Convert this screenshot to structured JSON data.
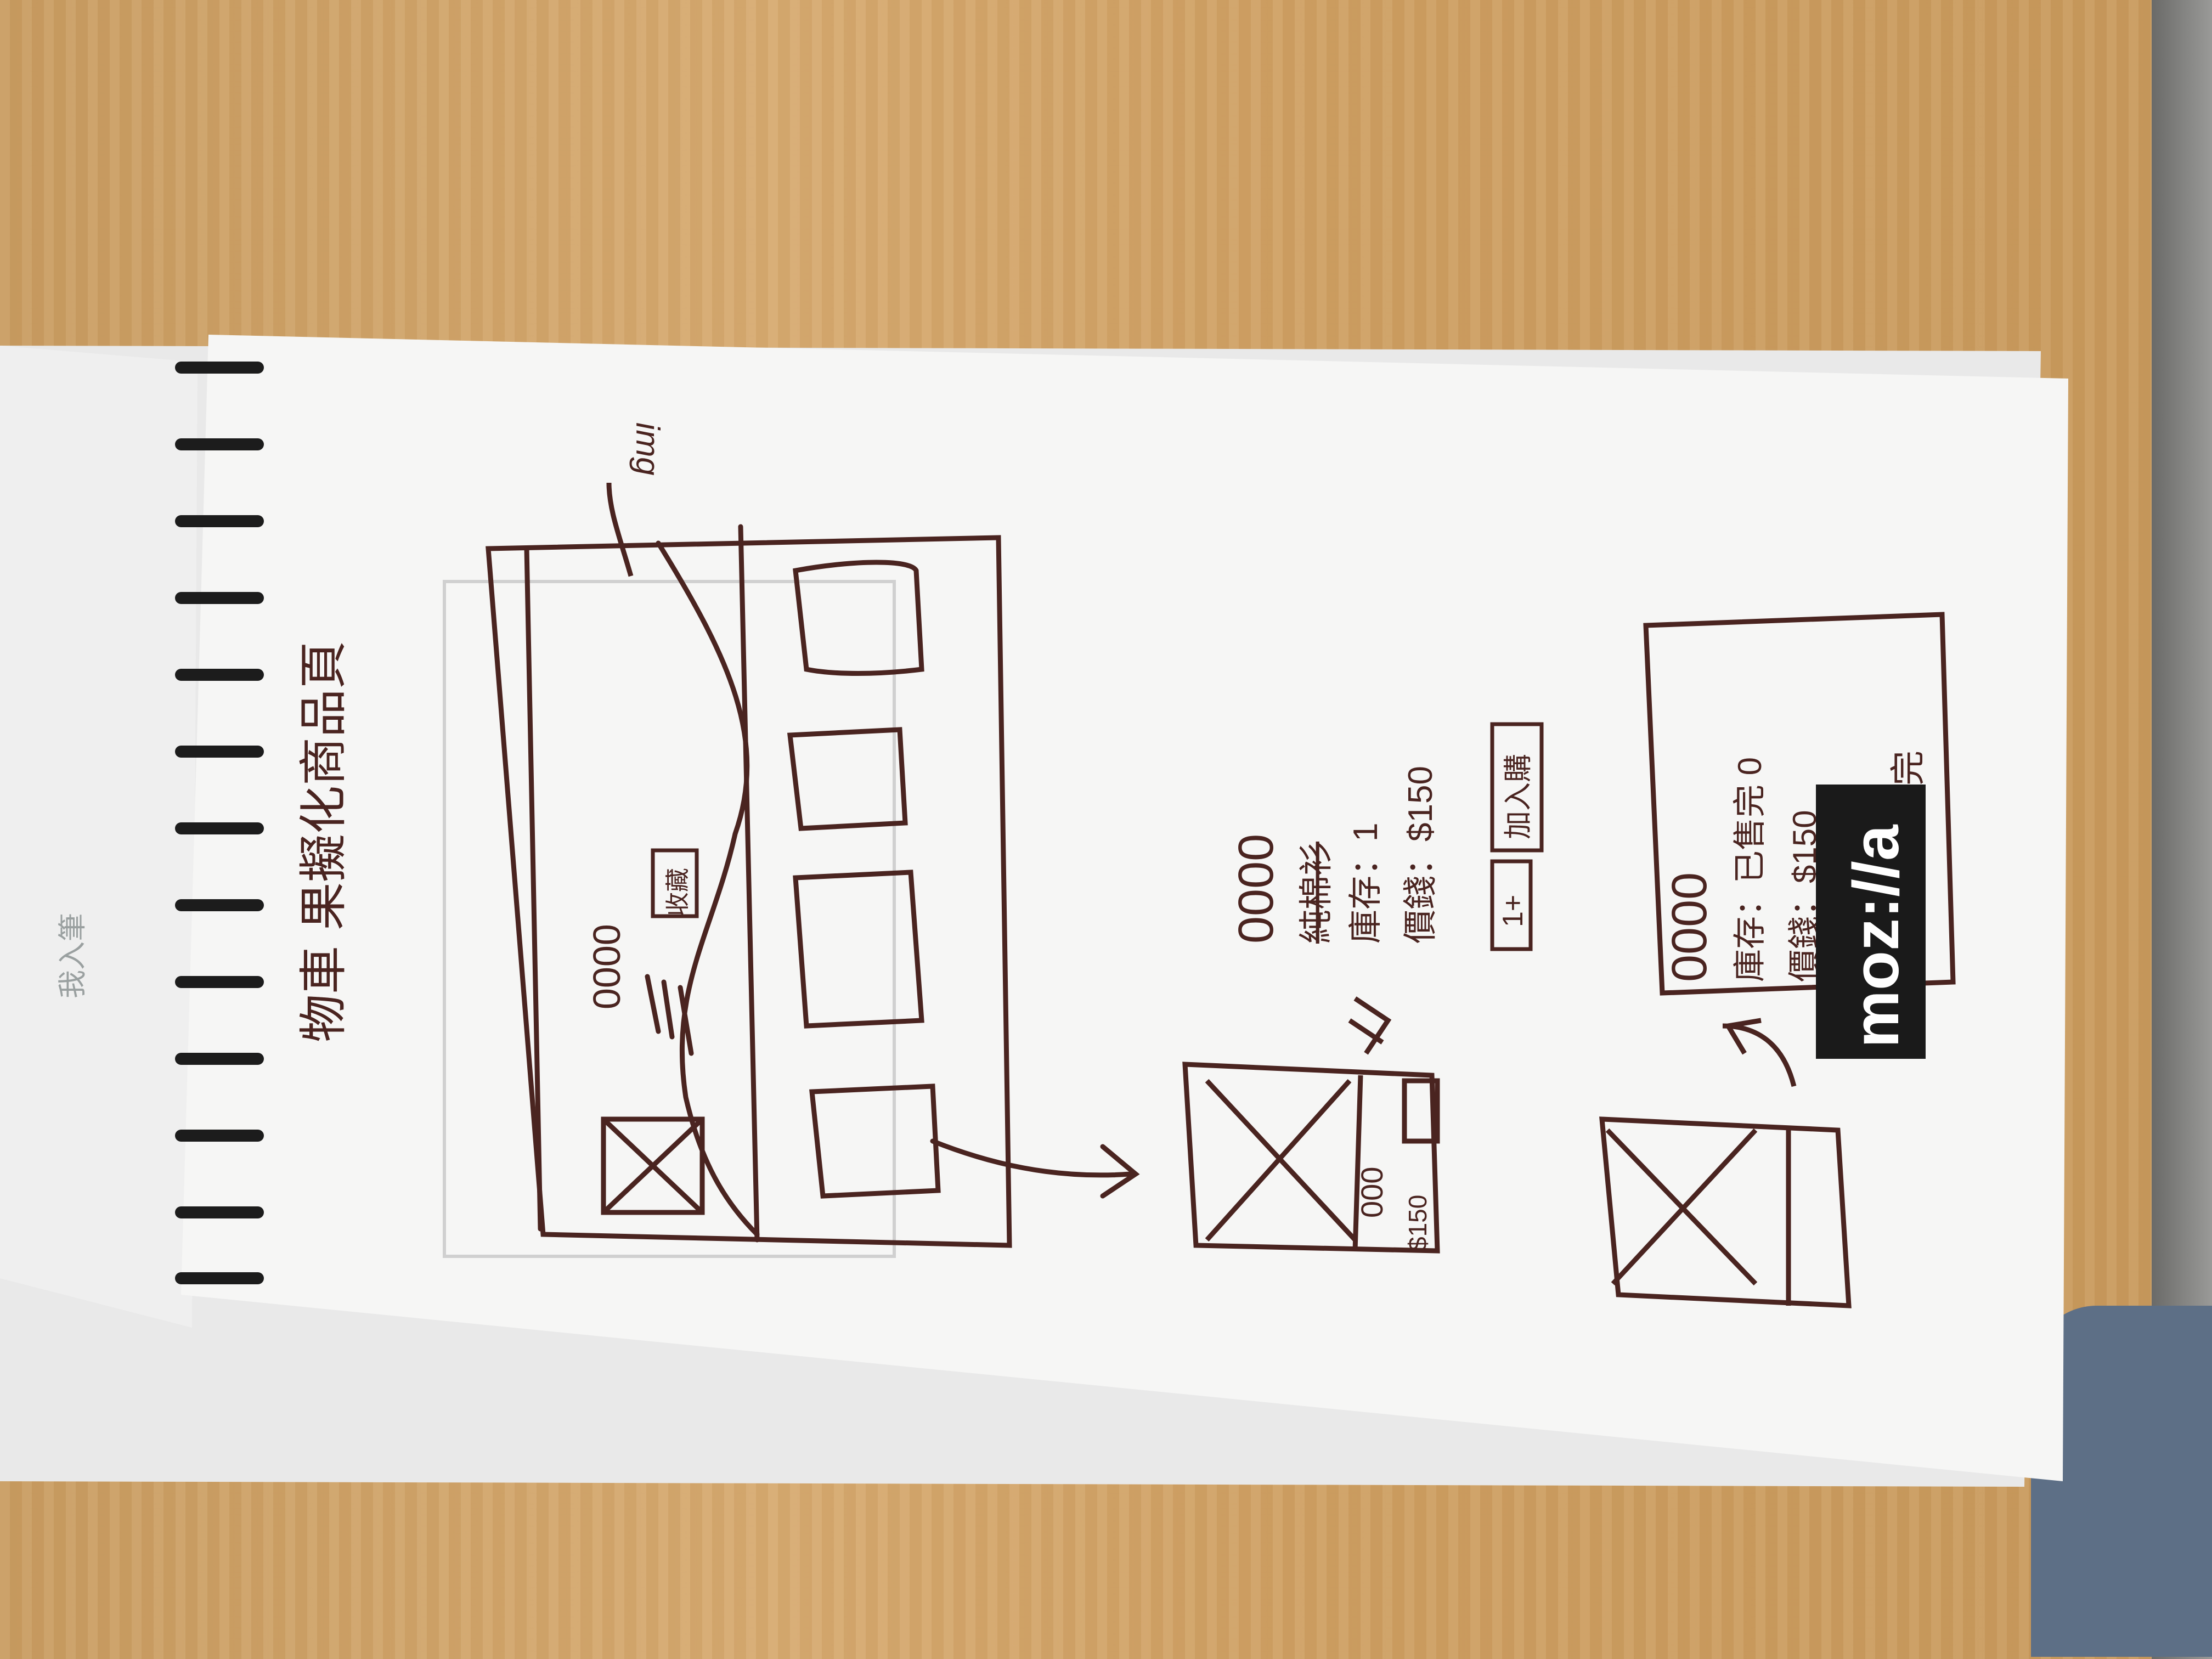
{
  "title": "物車 果擬化商品頁",
  "label_img": "img",
  "label_favorite": "收藏",
  "detail": {
    "rating": "0000",
    "name_struck": "純棉衫",
    "stock": "庫存：1",
    "price": "價錢：$150",
    "qty": "1+",
    "add_to_cart": "加入購"
  },
  "soldout": {
    "rating": "0000",
    "stock": "庫存：已售完 0",
    "price": "價錢：$150",
    "sold_out": "已售完"
  },
  "thumb_price": "$150",
  "thumb_rating": "000",
  "brand_sticker": "moz://a",
  "margin_scribble": "我入筆"
}
